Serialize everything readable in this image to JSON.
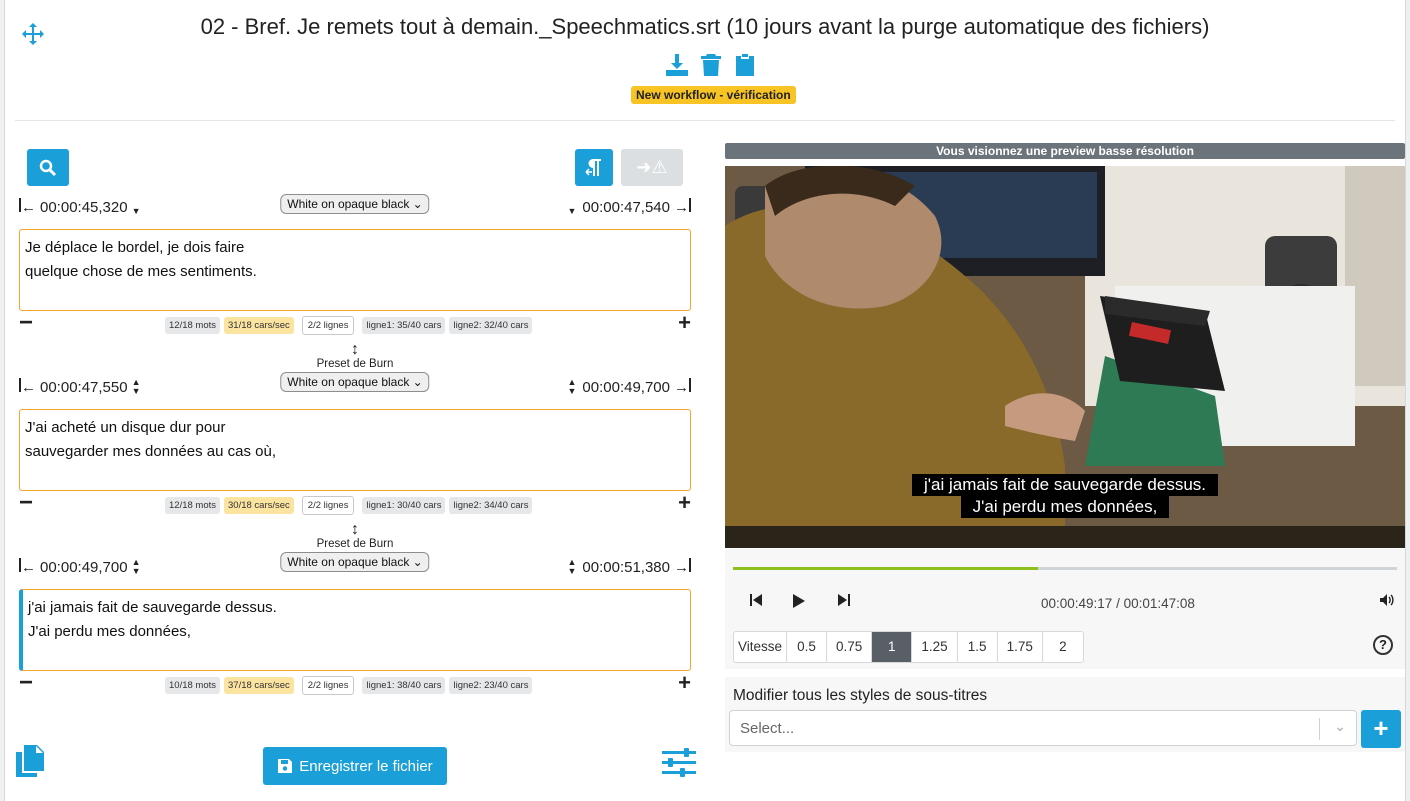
{
  "header": {
    "title": "02 - Bref. Je remets tout à demain._Speechmatics.srt (10 jours avant la purge automatique des fichiers)",
    "workflow_badge": "New workflow - vérification"
  },
  "toolbar": {
    "arrow_warning_glyph": "➜⚠"
  },
  "subtitles": [
    {
      "start": "00:00:45,320",
      "end": "00:00:47,540",
      "preset_label": "",
      "preset": "White on opaque black",
      "line1": "Je déplace le bordel, je dois faire",
      "line2": "quelque chose de mes sentiments.",
      "words": "12/18 mots",
      "cps": "31/18 cars/sec",
      "lines": "2/2 lignes",
      "l1": "ligne1: 35/40 cars",
      "l2": "ligne2: 32/40 cars"
    },
    {
      "start": "00:00:47,550",
      "end": "00:00:49,700",
      "preset_label": "Preset de Burn",
      "preset": "White on opaque black",
      "line1": "J'ai acheté un disque dur pour",
      "line2": "sauvegarder mes données au cas où,",
      "words": "12/18 mots",
      "cps": "30/18 cars/sec",
      "lines": "2/2 lignes",
      "l1": "ligne1: 30/40 cars",
      "l2": "ligne2: 34/40 cars"
    },
    {
      "start": "00:00:49,700",
      "end": "00:00:51,380",
      "preset_label": "Preset de Burn",
      "preset": "White on opaque black",
      "line1": "j'ai jamais fait de sauvegarde dessus.",
      "line2": "J'ai perdu mes données,",
      "words": "10/18 mots",
      "cps": "37/18 cars/sec",
      "lines": "2/2 lignes",
      "l1": "ligne1: 38/40 cars",
      "l2": "ligne2: 23/40 cars"
    }
  ],
  "footer": {
    "save_label": "Enregistrer le fichier"
  },
  "player": {
    "preview_notice": "Vous visionnez une preview basse résolution",
    "overlay_line1": "j'ai jamais fait de sauvegarde dessus.",
    "overlay_line2": "J'ai perdu mes données,",
    "time": "00:00:49:17 / 00:01:47:08",
    "progress_fraction": 0.46,
    "speed_label": "Vitesse",
    "speeds": [
      "0.5",
      "0.75",
      "1",
      "1.25",
      "1.5",
      "1.75",
      "2"
    ],
    "active_speed": "1"
  },
  "styles_panel": {
    "label": "Modifier tous les styles de sous-titres",
    "placeholder": "Select..."
  },
  "colors": {
    "accent": "#1a9fd8",
    "warning": "#f7c325",
    "border_active": "#f4a52a",
    "progress": "#8dbf1f"
  }
}
